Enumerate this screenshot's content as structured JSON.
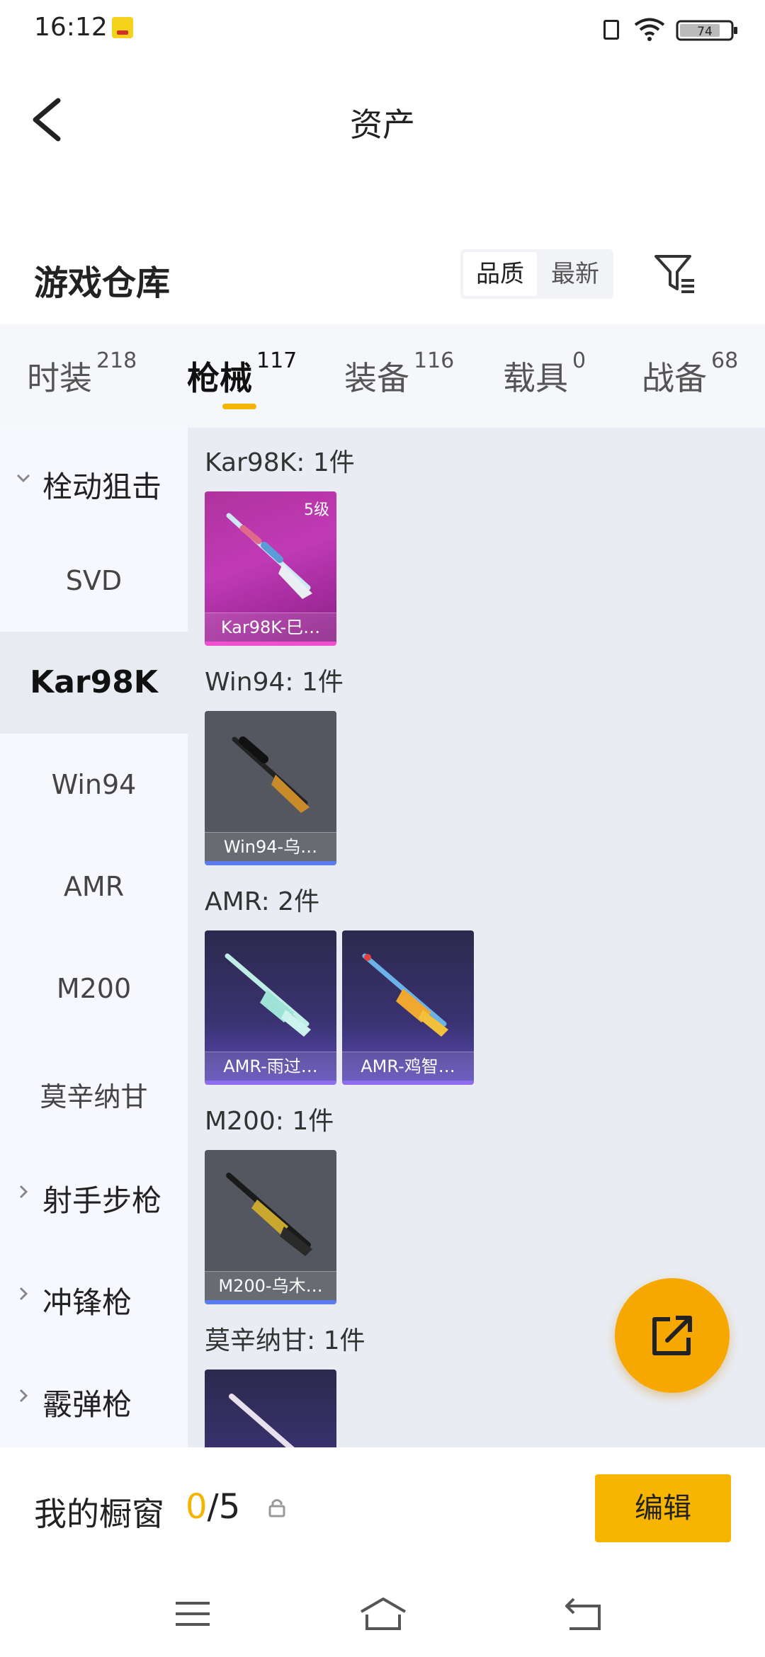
{
  "status_bar": {
    "time": "16:12",
    "battery": "74"
  },
  "header": {
    "title": "资产"
  },
  "warehouse": {
    "title": "游戏仓库",
    "sort_options": [
      "品质",
      "最新"
    ],
    "sort_selected": "品质"
  },
  "tabs": [
    {
      "label": "时装",
      "count": "218"
    },
    {
      "label": "枪械",
      "count": "117",
      "active": true
    },
    {
      "label": "装备",
      "count": "116"
    },
    {
      "label": "载具",
      "count": "0"
    },
    {
      "label": "战备",
      "count": "68"
    }
  ],
  "sidebar": {
    "group_open": "栓动狙击",
    "items": [
      "SVD",
      "Kar98K",
      "Win94",
      "AMR",
      "M200",
      "莫辛纳甘"
    ],
    "selected": "Kar98K",
    "groups_closed": [
      "射手步枪",
      "冲锋枪",
      "霰弹枪"
    ]
  },
  "content": {
    "groups": [
      {
        "title": "Kar98K: 1件",
        "cards": [
          {
            "name": "Kar98K-巳…",
            "level": "5级",
            "rarity": "pink"
          }
        ]
      },
      {
        "title": "Win94: 1件",
        "cards": [
          {
            "name": "Win94-乌…",
            "rarity": "grey"
          }
        ]
      },
      {
        "title": "AMR: 2件",
        "cards": [
          {
            "name": "AMR-雨过…",
            "rarity": "purple"
          },
          {
            "name": "AMR-鸡智…",
            "rarity": "purple"
          }
        ]
      },
      {
        "title": "M200: 1件",
        "cards": [
          {
            "name": "M200-乌木…",
            "rarity": "grey"
          }
        ]
      },
      {
        "title": "莫辛纳甘: 1件",
        "cards": [
          {
            "name": "",
            "rarity": "purple"
          }
        ]
      }
    ]
  },
  "showcase": {
    "label": "我的橱窗",
    "used": "0",
    "sep": "/",
    "total": "5",
    "edit_label": "编辑"
  },
  "colors": {
    "accent": "#f5b400",
    "fab": "#f7a800"
  }
}
